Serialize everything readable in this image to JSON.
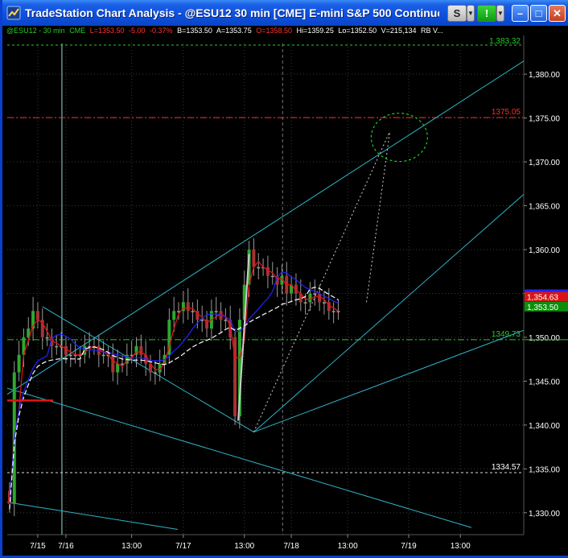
{
  "window": {
    "title": "TradeStation Chart Analysis - @ESU12 30 min [CME] E-mini S&P 500 Continuous C...",
    "s_button": "S",
    "g_button": "!",
    "dropdown_glyph": "▼",
    "minimize_glyph": "–",
    "maximize_glyph": "□",
    "close_glyph": "✕"
  },
  "status_bar": {
    "symbol": "@ESU12 - 30 min",
    "exchange": "CME",
    "last": "L=1353.50",
    "change": "-5.00",
    "change_pct": "-0.37%",
    "bid": "B=1353.50",
    "ask": "A=1353.75",
    "open": "O=1358.50",
    "high": "Hi=1359.25",
    "low": "Lo=1352.50",
    "volume": "V=215,134",
    "more": "RB V..."
  },
  "colors": {
    "background": "#000000",
    "grid": "#3a3a3a",
    "bar_up": "#2ea82e",
    "bar_down": "#a83232",
    "bar_neutral": "#9a9a9a",
    "channel": "#2fb3c8",
    "resistance": "#ff2a2a",
    "support": "#27c927",
    "projection_circle": "#22cc22",
    "ma_fast": "#e01515",
    "ma_mid": "#2222ff",
    "ma_slow": "#ffffff",
    "price_axis_text": "#ffffff",
    "price_tag_red": "#d81515",
    "price_tag_green": "#0b8f0b"
  },
  "chart_data": {
    "type": "candlestick",
    "symbol": "@ESU12",
    "interval": "30 min",
    "y_ticks": [
      "1,380.00",
      "1,375.00",
      "1,370.00",
      "1,365.00",
      "1,360.00",
      "1,355.00",
      "1,350.00",
      "1,345.00",
      "1,340.00",
      "1,335.00",
      "1,330.00"
    ],
    "y_tick_values": [
      1380,
      1375,
      1370,
      1365,
      1360,
      1355,
      1350,
      1345,
      1340,
      1335,
      1330
    ],
    "ylim": [
      1327.5,
      1383.5
    ],
    "x_ticks": [
      "7/15",
      "7/16",
      "13:00",
      "7/17",
      "13:00",
      "7/18",
      "13:00",
      "7/19",
      "13:00"
    ],
    "x_tick_index": [
      6,
      12,
      26,
      37,
      50,
      60,
      72,
      85,
      96
    ],
    "x_total": 110,
    "price_labels": {
      "top": "1,383.32",
      "resistance": "1375.05",
      "last_red": "1,354.63",
      "last_green": "1,353.50",
      "support": "1349.73",
      "lower": "1334.57"
    },
    "levels": {
      "top": 1383.32,
      "resistance": 1375.05,
      "support": 1349.73,
      "lower": 1334.57,
      "last_red": 1354.63,
      "last_green": 1353.5
    },
    "series_close": [
      1331,
      1346,
      1348,
      1350,
      1351,
      1353,
      1352,
      1350,
      1350,
      1349,
      1349,
      1349,
      1348,
      1348,
      1348,
      1348,
      1349,
      1349,
      1349,
      1348,
      1348,
      1348,
      1346,
      1347,
      1347,
      1348,
      1348,
      1349,
      1348,
      1347,
      1346,
      1346,
      1347,
      1348,
      1352,
      1353,
      1353,
      1354,
      1353,
      1353,
      1352,
      1352,
      1351,
      1353,
      1353,
      1352,
      1352,
      1350,
      1341,
      1352,
      1356,
      1360,
      1358,
      1358,
      1358,
      1357,
      1357,
      1356,
      1357,
      1355,
      1356,
      1355,
      1354,
      1354,
      1355,
      1355,
      1354,
      1354,
      1353,
      1353,
      1353
    ]
  }
}
